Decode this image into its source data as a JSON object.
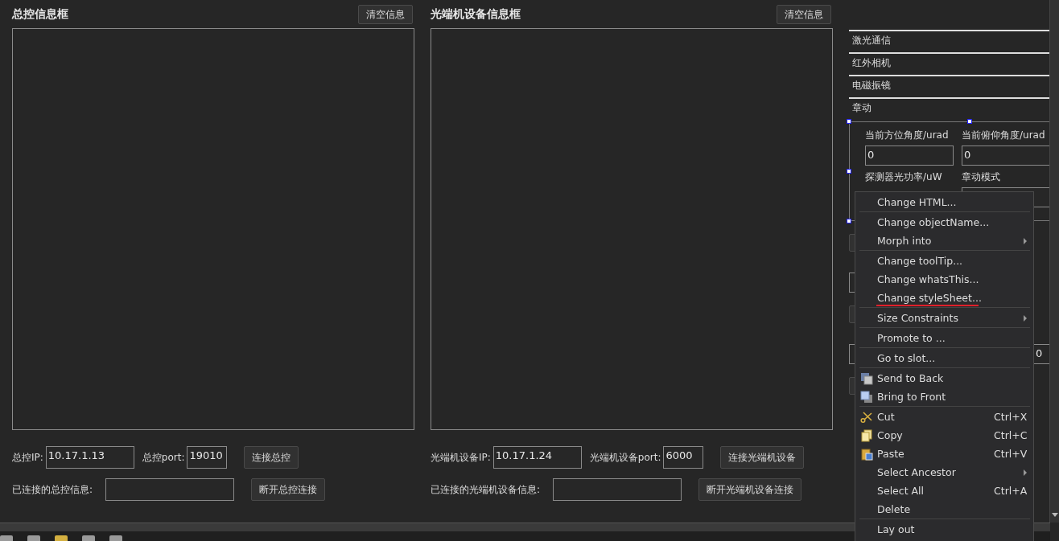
{
  "panels": [
    {
      "title": "总控信息框",
      "clear_button": "清空信息",
      "ip_label": "总控IP:",
      "ip_value": "10.17.1.13",
      "port_label": "总控port:",
      "port_value": "19010",
      "connect_button": "连接总控",
      "info_label": "已连接的总控信息:",
      "disconnect_button": "断开总控连接"
    },
    {
      "title": "光端机设备信息框",
      "clear_button": "清空信息",
      "ip_label": "光端机设备IP:",
      "ip_value": "10.17.1.24",
      "port_label": "光端机设备port:",
      "port_value": "6000",
      "connect_button": "连接光端机设备",
      "info_label": "已连接的光端机设备信息:",
      "disconnect_button": "断开光端机设备连接"
    }
  ],
  "side": {
    "sections": [
      "激光通信",
      "红外相机",
      "电磁振镜",
      "章动"
    ],
    "group": {
      "fields": [
        {
          "label": "当前方位角度/urad",
          "value": "0"
        },
        {
          "label": "当前俯仰角度/urad",
          "value": "0"
        }
      ],
      "labels": [
        "探测器光功率/uW",
        "章动模式"
      ]
    },
    "fragments": {
      "value": "0"
    }
  },
  "context_menu": [
    {
      "kind": "item",
      "label": "Change HTML..."
    },
    {
      "kind": "separator"
    },
    {
      "kind": "item",
      "label": "Change objectName..."
    },
    {
      "kind": "item",
      "label": "Morph into",
      "submenu": true
    },
    {
      "kind": "separator"
    },
    {
      "kind": "item",
      "label": "Change toolTip..."
    },
    {
      "kind": "item",
      "label": "Change whatsThis..."
    },
    {
      "kind": "item",
      "label": "Change styleSheet...",
      "annotated": true
    },
    {
      "kind": "separator"
    },
    {
      "kind": "item",
      "label": "Size Constraints",
      "submenu": true
    },
    {
      "kind": "separator"
    },
    {
      "kind": "item",
      "label": "Promote to ..."
    },
    {
      "kind": "separator"
    },
    {
      "kind": "item",
      "label": "Go to slot..."
    },
    {
      "kind": "separator"
    },
    {
      "kind": "back",
      "label": "Send to Back"
    },
    {
      "kind": "front",
      "label": "Bring to Front"
    },
    {
      "kind": "separator"
    },
    {
      "kind": "cut",
      "label": "Cut",
      "shortcut": "Ctrl+X"
    },
    {
      "kind": "copy",
      "label": "Copy",
      "shortcut": "Ctrl+C"
    },
    {
      "kind": "paste",
      "label": "Paste",
      "shortcut": "Ctrl+V"
    },
    {
      "kind": "item",
      "label": "Select Ancestor",
      "submenu": true
    },
    {
      "kind": "item",
      "label": "Select All",
      "shortcut": "Ctrl+A"
    },
    {
      "kind": "item",
      "label": "Delete"
    },
    {
      "kind": "separator"
    },
    {
      "kind": "item",
      "label": "Lay out"
    }
  ]
}
